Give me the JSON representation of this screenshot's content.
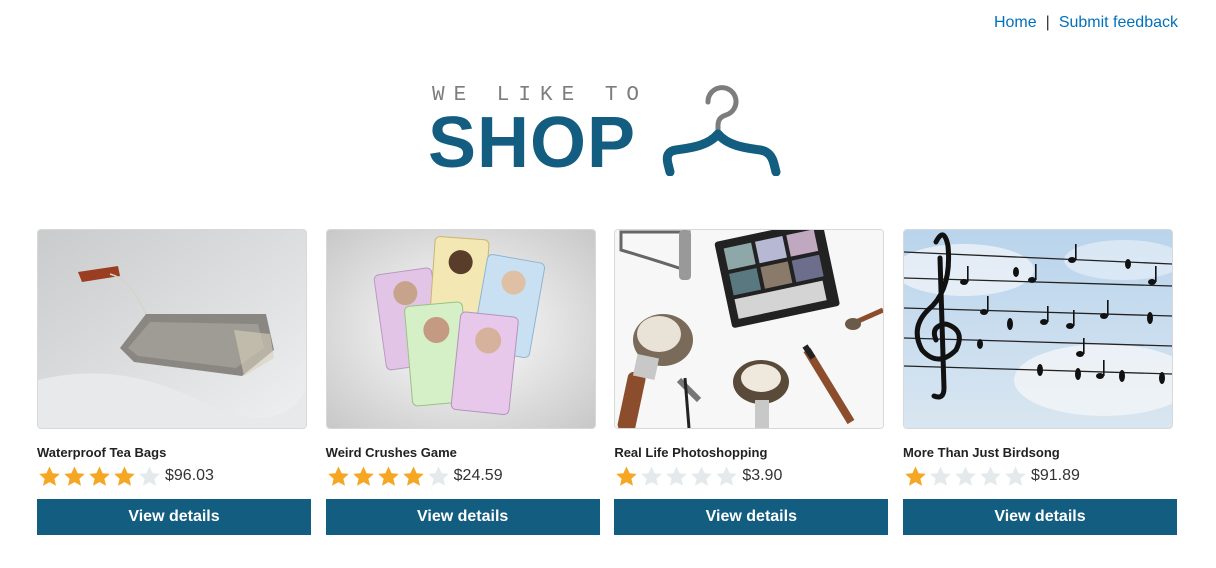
{
  "nav": {
    "home_label": "Home",
    "separator": "|",
    "feedback_label": "Submit feedback"
  },
  "logo": {
    "tagline": "WE LIKE TO",
    "wordmark": "SHOP"
  },
  "colors": {
    "brand": "#135d80",
    "link": "#0071bc",
    "star_filled": "#f5a623",
    "star_empty": "#e4e9ec"
  },
  "products": [
    {
      "name": "Waterproof Tea Bags",
      "rating": 4,
      "max_rating": 5,
      "price": "$96.03",
      "button_label": "View details",
      "image": "tea-bag-photo"
    },
    {
      "name": "Weird Crushes Game",
      "rating": 4,
      "max_rating": 5,
      "price": "$24.59",
      "button_label": "View details",
      "image": "trading-cards-photo"
    },
    {
      "name": "Real Life Photoshopping",
      "rating": 1,
      "max_rating": 5,
      "price": "$3.90",
      "button_label": "View details",
      "image": "makeup-brushes-photo"
    },
    {
      "name": "More Than Just Birdsong",
      "rating": 1,
      "max_rating": 5,
      "price": "$91.89",
      "button_label": "View details",
      "image": "birds-music-notes-photo"
    }
  ]
}
